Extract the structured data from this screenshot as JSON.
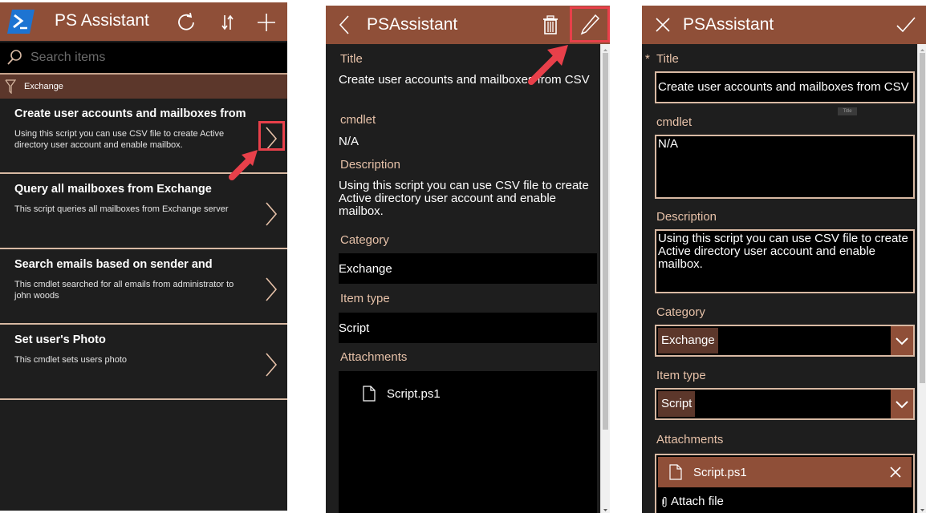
{
  "colors": {
    "appbar": "#8f4f38",
    "accent_dark": "#5c372b",
    "label": "#e6c1a8",
    "divider": "#d8b9a3",
    "background": "#1e1e1e",
    "highlight": "#e8404a",
    "logo": "#1d74d2"
  },
  "list_screen": {
    "app_title": "PS Assistant",
    "icons": [
      "powershell-logo",
      "refresh-icon",
      "sort-icon",
      "add-icon"
    ],
    "search": {
      "placeholder": "Search items",
      "value": ""
    },
    "filter": {
      "icon": "filter-icon",
      "label": "Exchange"
    },
    "items": [
      {
        "title": "Create user accounts and mailboxes from",
        "description": "Using this script you can use CSV file to create Active directory user account and enable mailbox."
      },
      {
        "title": "Query all mailboxes from Exchange",
        "description": "This script queries all mailboxes from Exchange server"
      },
      {
        "title": "Search emails based on sender and",
        "description": "This cmdlet searched for all emails from administrator to john woods"
      },
      {
        "title": "Set user's Photo",
        "description": "This cmdlet sets users photo"
      }
    ]
  },
  "detail_screen": {
    "app_title": "PSAssistant",
    "icons": [
      "back-icon",
      "trash-icon",
      "edit-icon"
    ],
    "fields": {
      "title_label": "Title",
      "title_value": "Create user accounts and mailboxes from CSV",
      "cmdlet_label": "cmdlet",
      "cmdlet_value": "N/A",
      "description_label": "Description",
      "description_value": "Using this script you can use CSV file to create Active directory user account and enable mailbox.",
      "category_label": "Category",
      "category_value": "Exchange",
      "item_type_label": "Item type",
      "item_type_value": "Script",
      "attachments_label": "Attachments",
      "attachment_name": "Script.ps1"
    }
  },
  "edit_screen": {
    "app_title": "PSAssistant",
    "icons": [
      "close-icon",
      "check-icon"
    ],
    "required_marker": "*",
    "fields": {
      "title_label": "Title",
      "title_value": "Create user accounts and mailboxes from CSV",
      "title_tooltip": "Title",
      "cmdlet_label": "cmdlet",
      "cmdlet_value": "N/A",
      "description_label": "Description",
      "description_value": "Using this script you can use CSV file to create Active directory user account and enable mailbox.",
      "category_label": "Category",
      "category_value": "Exchange",
      "item_type_label": "Item type",
      "item_type_value": "Script",
      "attachments_label": "Attachments",
      "attachment_name": "Script.ps1",
      "attach_file_label": "Attach file"
    }
  }
}
